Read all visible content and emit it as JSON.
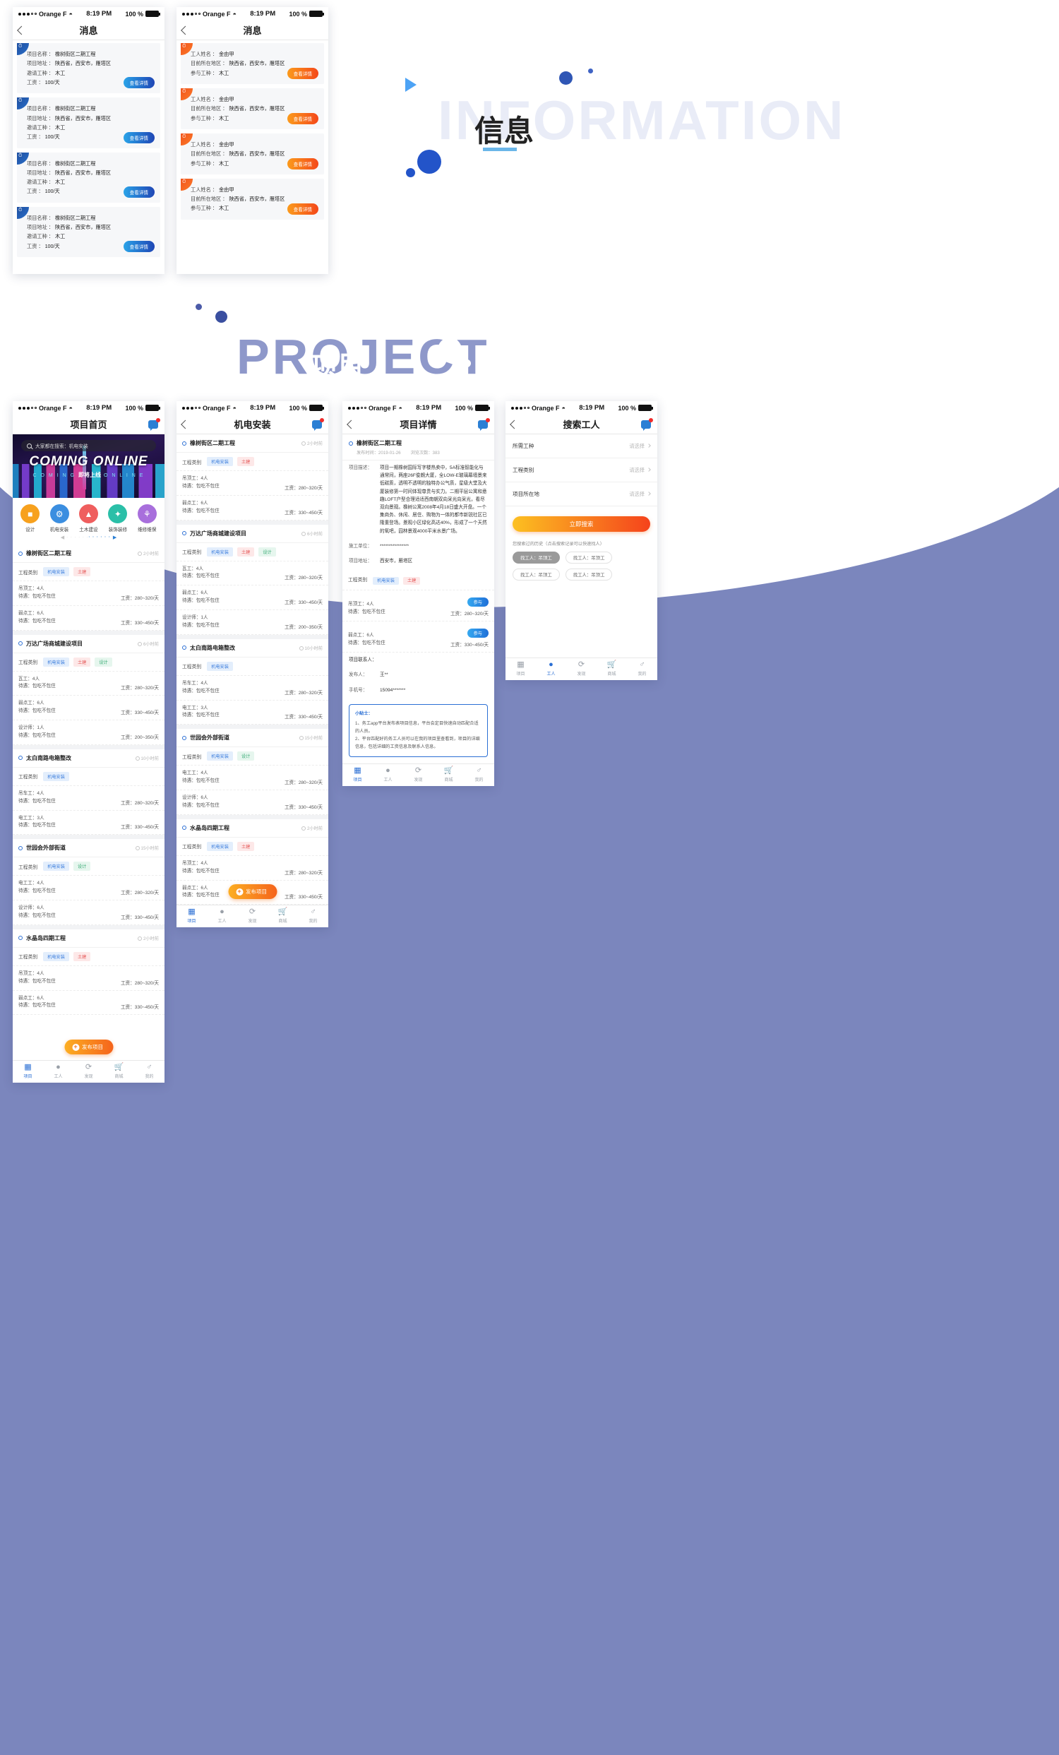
{
  "decor": {
    "info_word": "INFORMATION",
    "info_cn": "信息",
    "project_word": "PROJECT",
    "project_cn": "项目"
  },
  "status_bar": {
    "carrier": "Orange F",
    "time": "8:19 PM",
    "battery": "100 %"
  },
  "screens": {
    "messages_project": {
      "title": "消息",
      "cards": [
        {
          "l1_k": "项目名称",
          "l1_v": "橡树街区二期工程",
          "l2_k": "项目地址",
          "l2_v": "陕西省，西安市，雁塔区",
          "l3_k": "邀请工种",
          "l3_v": "木工",
          "l4_k": "工资",
          "l4_v": "100/天",
          "btn": "查看详情"
        },
        {
          "l1_k": "项目名称",
          "l1_v": "橡树街区二期工程",
          "l2_k": "项目地址",
          "l2_v": "陕西省，西安市，雁塔区",
          "l3_k": "邀请工种",
          "l3_v": "木工",
          "l4_k": "工资",
          "l4_v": "100/天",
          "btn": "查看详情"
        },
        {
          "l1_k": "项目名称",
          "l1_v": "橡树街区二期工程",
          "l2_k": "项目地址",
          "l2_v": "陕西省，西安市，雁塔区",
          "l3_k": "邀请工种",
          "l3_v": "木工",
          "l4_k": "工资",
          "l4_v": "100/天",
          "btn": "查看详情"
        },
        {
          "l1_k": "项目名称",
          "l1_v": "橡树街区二期工程",
          "l2_k": "项目地址",
          "l2_v": "陕西省，西安市，雁塔区",
          "l3_k": "邀请工种",
          "l3_v": "木工",
          "l4_k": "工资",
          "l4_v": "100/天",
          "btn": "查看详情"
        }
      ]
    },
    "messages_worker": {
      "title": "消息",
      "cards": [
        {
          "l1_k": "工人姓名",
          "l1_v": "金由甲",
          "l2_k": "目前所在地区",
          "l2_v": "陕西省，西安市，雁塔区",
          "l3_k": "参与工种",
          "l3_v": "木工",
          "btn": "查看详情"
        },
        {
          "l1_k": "工人姓名",
          "l1_v": "金由甲",
          "l2_k": "目前所在地区",
          "l2_v": "陕西省，西安市，雁塔区",
          "l3_k": "参与工种",
          "l3_v": "木工",
          "btn": "查看详情"
        },
        {
          "l1_k": "工人姓名",
          "l1_v": "金由甲",
          "l2_k": "目前所在地区",
          "l2_v": "陕西省，西安市，雁塔区",
          "l3_k": "参与工种",
          "l3_v": "木工",
          "btn": "查看详情"
        },
        {
          "l1_k": "工人姓名",
          "l1_v": "金由甲",
          "l2_k": "目前所在地区",
          "l2_v": "陕西省，西安市，雁塔区",
          "l3_k": "参与工种",
          "l3_v": "木工",
          "btn": "查看详情"
        }
      ]
    },
    "home": {
      "title": "项目首页",
      "search_placeholder": "大家都在搜索：机电安装",
      "banner": {
        "title": "COMING ONLINE",
        "sub_left": "C O M I N G",
        "sub_cn": "即将上线",
        "sub_right": "O N L I N E"
      },
      "categories": [
        {
          "label": "设计",
          "icon": "paint-roller-icon",
          "color": "#f7a11e"
        },
        {
          "label": "机电安装",
          "icon": "gear-search-icon",
          "color": "#3b8ee0"
        },
        {
          "label": "土木建设",
          "icon": "brick-trowel-icon",
          "color": "#ef5e5e"
        },
        {
          "label": "装饰装修",
          "icon": "decor-icon",
          "color": "#2bbfa8"
        },
        {
          "label": "维修维保",
          "icon": "wrench-icon",
          "color": "#a86fdc"
        }
      ],
      "fab": "发布项目",
      "projects": [
        {
          "name": "橡树街区二期工程",
          "time": "2小时前",
          "cat_label": "工程类别",
          "tags": [
            {
              "t": "机电安装",
              "c": "blue"
            },
            {
              "t": "土建",
              "c": "red"
            }
          ],
          "jobs": [
            {
              "role": "吊顶工：4人",
              "benefit": "待遇：包吃不包住",
              "wage": "工资：280~320/天"
            },
            {
              "role": "弱点工：6人",
              "benefit": "待遇：包吃不包住",
              "wage": "工资：330~450/天"
            }
          ]
        },
        {
          "name": "万达广场商城建设项目",
          "time": "6小时前",
          "cat_label": "工程类别",
          "tags": [
            {
              "t": "机电安装",
              "c": "blue"
            },
            {
              "t": "土建",
              "c": "red"
            },
            {
              "t": "设计",
              "c": "green"
            }
          ],
          "jobs": [
            {
              "role": "瓦工：4人",
              "benefit": "待遇：包吃不包住",
              "wage": "工资：280~320/天"
            },
            {
              "role": "弱点工：6人",
              "benefit": "待遇：包吃不包住",
              "wage": "工资：330~450/天"
            },
            {
              "role": "设计师：1人",
              "benefit": "待遇：包吃不包住",
              "wage": "工资：200~350/天"
            }
          ]
        },
        {
          "name": "太白南路电箱整改",
          "time": "10小时前",
          "cat_label": "工程类别",
          "tags": [
            {
              "t": "机电安装",
              "c": "blue"
            }
          ],
          "jobs": [
            {
              "role": "吊车工：4人",
              "benefit": "待遇：包吃不包住",
              "wage": "工资：280~320/天"
            },
            {
              "role": "电工工：3人",
              "benefit": "待遇：包吃不包住",
              "wage": "工资：330~450/天"
            }
          ]
        },
        {
          "name": "世园会外部街道",
          "time": "15小时前",
          "cat_label": "工程类别",
          "tags": [
            {
              "t": "机电安装",
              "c": "blue"
            },
            {
              "t": "设计",
              "c": "green"
            }
          ],
          "jobs": [
            {
              "role": "电工工：4人",
              "benefit": "待遇：包吃不包住",
              "wage": "工资：280~320/天"
            },
            {
              "role": "设计师：6人",
              "benefit": "待遇：包吃不包住",
              "wage": "工资：330~450/天"
            }
          ]
        },
        {
          "name": "水晶岛四期工程",
          "time": "2小时前",
          "cat_label": "工程类别",
          "tags": [
            {
              "t": "机电安装",
              "c": "blue"
            },
            {
              "t": "土建",
              "c": "red"
            }
          ],
          "jobs": [
            {
              "role": "吊顶工：4人",
              "benefit": "待遇：包吃不包住",
              "wage": "工资：280~320/天"
            },
            {
              "role": "弱点工：6人",
              "benefit": "待遇：包吃不包住",
              "wage": "工资：330~450/天"
            }
          ]
        }
      ]
    },
    "category": {
      "title": "机电安装",
      "fab": "发布项目",
      "projects": [
        {
          "name": "橡树街区二期工程",
          "time": "2小时前",
          "cat_label": "工程类别",
          "tags": [
            {
              "t": "机电安装",
              "c": "blue"
            },
            {
              "t": "土建",
              "c": "red"
            }
          ],
          "jobs": [
            {
              "role": "吊顶工：4人",
              "benefit": "待遇：包吃不包住",
              "wage": "工资：280~320/天"
            },
            {
              "role": "弱点工：6人",
              "benefit": "待遇：包吃不包住",
              "wage": "工资：330~450/天"
            }
          ]
        },
        {
          "name": "万达广场商城建设项目",
          "time": "6小时前",
          "cat_label": "工程类别",
          "tags": [
            {
              "t": "机电安装",
              "c": "blue"
            },
            {
              "t": "土建",
              "c": "red"
            },
            {
              "t": "设计",
              "c": "green"
            }
          ],
          "jobs": [
            {
              "role": "瓦工：4人",
              "benefit": "待遇：包吃不包住",
              "wage": "工资：280~320/天"
            },
            {
              "role": "弱点工：6人",
              "benefit": "待遇：包吃不包住",
              "wage": "工资：330~450/天"
            },
            {
              "role": "设计师：1人",
              "benefit": "待遇：包吃不包住",
              "wage": "工资：200~350/天"
            }
          ]
        },
        {
          "name": "太白南路电箱整改",
          "time": "10小时前",
          "cat_label": "工程类别",
          "tags": [
            {
              "t": "机电安装",
              "c": "blue"
            }
          ],
          "jobs": [
            {
              "role": "吊车工：4人",
              "benefit": "待遇：包吃不包住",
              "wage": "工资：280~320/天"
            },
            {
              "role": "电工工：3人",
              "benefit": "待遇：包吃不包住",
              "wage": "工资：330~450/天"
            }
          ]
        },
        {
          "name": "世园会外部街道",
          "time": "15小时前",
          "cat_label": "工程类别",
          "tags": [
            {
              "t": "机电安装",
              "c": "blue"
            },
            {
              "t": "设计",
              "c": "green"
            }
          ],
          "jobs": [
            {
              "role": "电工工：4人",
              "benefit": "待遇：包吃不包住",
              "wage": "工资：280~320/天"
            },
            {
              "role": "设计师：6人",
              "benefit": "待遇：包吃不包住",
              "wage": "工资：330~450/天"
            }
          ]
        },
        {
          "name": "水晶岛四期工程",
          "time": "2小时前",
          "cat_label": "工程类别",
          "tags": [
            {
              "t": "机电安装",
              "c": "blue"
            },
            {
              "t": "土建",
              "c": "red"
            }
          ],
          "jobs": [
            {
              "role": "吊顶工：4人",
              "benefit": "待遇：包吃不包住",
              "wage": "工资：280~320/天"
            },
            {
              "role": "弱点工：6人",
              "benefit": "待遇：包吃不包住",
              "wage": "工资：330~450/天"
            }
          ]
        }
      ]
    },
    "detail": {
      "title": "项目详情",
      "project_name": "橡树街区二期工程",
      "publish_time": "发布时间：2019-01-26",
      "views": "浏览次数：383",
      "desc_key": "项目描述：",
      "desc_value": "项目一期橡树国际写字楼热卖中，5A标准智能化与通常间，两座26F俊朗大厦，全LOW-E玻璃幕墙景来低碳质，透明不透明的独特办公气质，星级大堂及大厦装修第一时间体现尊贵与实力。二期平层公寓和意趣LOFT户型合理适适西南朝双向采光向采光，看尽双向景观。橡树公寓2008年4月18日盛大开盘。一个集商务、休闲、居住、购物为一体的都市新锐社区已隆重登场。景观小区绿化高达40%，形成了一个天然的氧吧，园林景观4000平米水景广场。",
      "builder_key": "施工单位：",
      "builder_value": "****************",
      "address_key": "项目地址：",
      "address_value": "西安市，雁塔区",
      "cat_key": "工程类别",
      "tags": [
        {
          "t": "机电安装",
          "c": "blue"
        },
        {
          "t": "土建",
          "c": "red"
        }
      ],
      "jobs": [
        {
          "role": "吊顶工：4人",
          "benefit": "待遇：包吃不包住",
          "wage": "工资：280~320/天",
          "btn": "参与"
        },
        {
          "role": "弱点工：6人",
          "benefit": "待遇：包吃不包住",
          "wage": "工资：330~450/天",
          "btn": "参与"
        }
      ],
      "contact_key": "项目联系人：",
      "publisher_key": "发布人：",
      "publisher_value": "王**",
      "phone_key": "手机号：",
      "phone_value": "15094*******",
      "tip_title": "小贴士：",
      "tip_1": "1、务工app平台发布表项目信息，平台会定目快速自动匹配合适的人员。",
      "tip_2": "2、平台匹配好的务工人员可以在我的项目里查看到，项目的详细信息，包括详细的工资信息及联系人信息。"
    },
    "search_worker": {
      "title": "搜索工人",
      "fields": [
        {
          "label": "所需工种",
          "value": "请选择"
        },
        {
          "label": "工程类别",
          "value": "请选择"
        },
        {
          "label": "项目所在地",
          "value": "请选择"
        }
      ],
      "search_btn": "立即搜索",
      "history_note": "您搜索过的历史（点击搜索记录可以快速找人）",
      "history_chips": [
        "找工人：吊顶工",
        "找工人：吊顶工",
        "找工人：吊顶工",
        "找工人：吊顶工"
      ]
    }
  },
  "tabbar": [
    {
      "label": "项目",
      "icon": "grid-icon"
    },
    {
      "label": "工人",
      "icon": "worker-icon"
    },
    {
      "label": "发现",
      "icon": "compass-icon"
    },
    {
      "label": "商城",
      "icon": "cart-icon"
    },
    {
      "label": "我的",
      "icon": "user-icon"
    }
  ]
}
